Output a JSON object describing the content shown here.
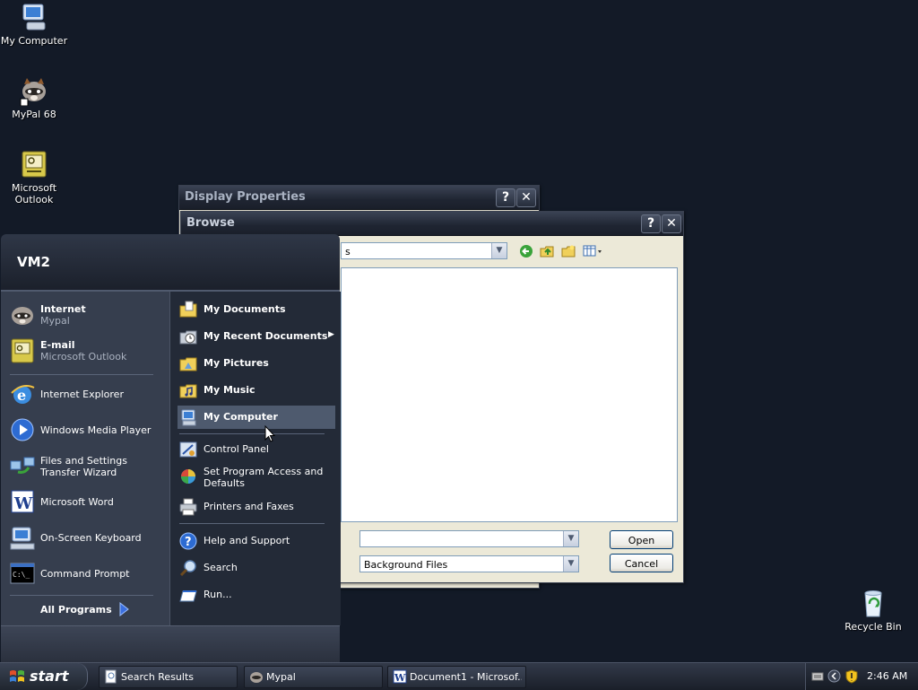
{
  "desktop": {
    "icons": [
      {
        "label": "My Computer"
      },
      {
        "label": "MyPal 68"
      },
      {
        "label": "Microsoft Outlook"
      },
      {
        "label": "Recycle Bin"
      }
    ]
  },
  "display_window": {
    "title": "Display Properties",
    "help_label": "?",
    "close_label": "✕"
  },
  "browse_dialog": {
    "title": "Browse",
    "help_label": "?",
    "close_label": "✕",
    "lookin_value": "s",
    "filename_value": "",
    "filetype_value": "Background Files",
    "open_label": "Open",
    "cancel_label": "Cancel"
  },
  "start_menu": {
    "user": "VM2",
    "pinned": [
      {
        "title": "Internet",
        "subtitle": "Mypal"
      },
      {
        "title": "E-mail",
        "subtitle": "Microsoft Outlook"
      }
    ],
    "recent": [
      "Internet Explorer",
      "Windows Media Player",
      "Files and Settings Transfer Wizard",
      "Microsoft Word",
      "On-Screen Keyboard",
      "Command Prompt"
    ],
    "all_programs": "All Programs",
    "places": [
      "My Documents",
      "My Recent Documents",
      "My Pictures",
      "My Music",
      "My Computer"
    ],
    "system": [
      "Control Panel",
      "Set Program Access and Defaults",
      "Printers and Faxes"
    ],
    "support": [
      "Help and Support",
      "Search",
      "Run..."
    ]
  },
  "taskbar": {
    "start_label": "start",
    "tasks": [
      "Search Results",
      "Mypal",
      "Document1 - Microsof..."
    ],
    "clock": "2:46 AM"
  },
  "colors": {
    "desktop": "#131a27",
    "start_menu_left": "#363e4e",
    "start_menu_right": "#232a37",
    "highlight": "#4e5a6e"
  }
}
